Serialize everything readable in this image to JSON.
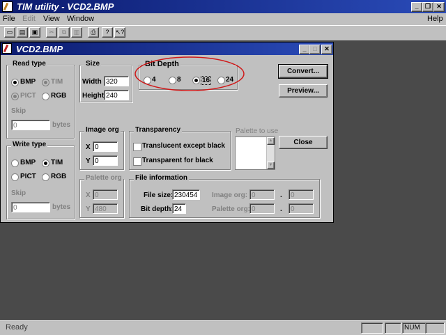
{
  "app": {
    "title": "TIM utility - VCD2.BMP",
    "menu": [
      "File",
      "Edit",
      "View",
      "Window"
    ],
    "help": "Help"
  },
  "dialog": {
    "title": "VCD2.BMP",
    "read_type": {
      "label": "Read type",
      "options": [
        "BMP",
        "TIM",
        "PICT",
        "RGB"
      ],
      "selected": "BMP",
      "skip_label": "Skip",
      "skip_value": "0",
      "bytes_label": "bytes"
    },
    "size": {
      "label": "Size",
      "width_label": "Width",
      "width_value": "320",
      "height_label": "Height",
      "height_value": "240"
    },
    "bit_depth": {
      "label": "Bit Depth",
      "options": [
        "4",
        "8",
        "16",
        "24"
      ],
      "selected": "16"
    },
    "buttons": {
      "convert": "Convert...",
      "preview": "Preview...",
      "close": "Close"
    },
    "image_org": {
      "label": "Image org",
      "x_label": "X",
      "x_value": "0",
      "y_label": "Y",
      "y_value": "0"
    },
    "transparency": {
      "label": "Transparency",
      "opt1": "Translucent except black",
      "opt2": "Transparent for black"
    },
    "palette_to_use": {
      "label": "Palette to use"
    },
    "write_type": {
      "label": "Write type",
      "options": [
        "BMP",
        "TIM",
        "PICT",
        "RGB"
      ],
      "selected": "TIM",
      "skip_label": "Skip",
      "skip_value": "0",
      "bytes_label": "bytes"
    },
    "palette_org": {
      "label": "Palette org",
      "x_label": "X",
      "x_value": "0",
      "y_label": "Y",
      "y_value": "480"
    },
    "file_info": {
      "label": "File information",
      "file_size_label": "File size:",
      "file_size_value": "230454",
      "bit_depth_label": "Bit depth:",
      "bit_depth_value": "24",
      "image_org_label": "Image org:",
      "image_org_x": "0",
      "image_org_y": "0",
      "palette_org_label": "Palette org:",
      "palette_org_x": "0",
      "palette_org_y": "0",
      "sep": "."
    }
  },
  "status": {
    "text": "Ready",
    "num": "NUM"
  },
  "colors": {
    "desktop": "#4a4a4a",
    "highlight_circle": "#d01818"
  }
}
